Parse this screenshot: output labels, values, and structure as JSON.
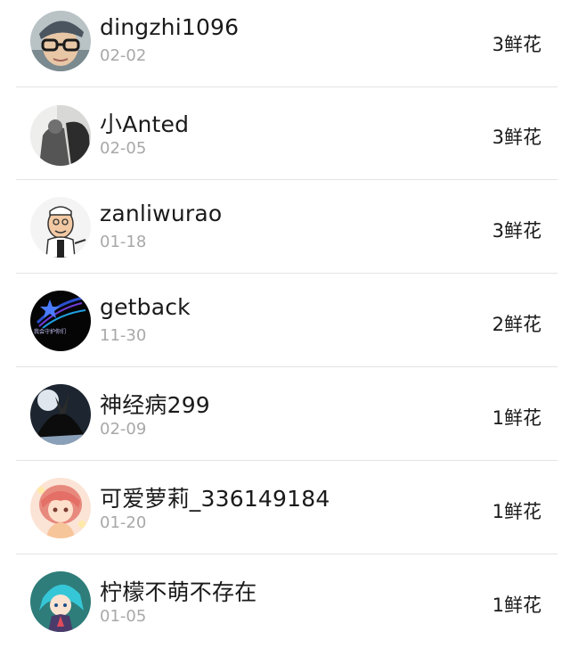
{
  "flower_list": {
    "items": [
      {
        "name": "dingzhi1096",
        "date": "02-02",
        "flowers": "3鲜花",
        "avatar": "boy-with-glasses-icon"
      },
      {
        "name": "小Anted",
        "date": "02-05",
        "flowers": "3鲜花",
        "avatar": "dark-photo-icon"
      },
      {
        "name": "zanliwurao",
        "date": "01-18",
        "flowers": "3鲜花",
        "avatar": "cartoon-chef-icon"
      },
      {
        "name": "getback",
        "date": "11-30",
        "flowers": "2鲜花",
        "avatar": "shooting-star-icon"
      },
      {
        "name": "神经病299",
        "date": "02-09",
        "flowers": "1鲜花",
        "avatar": "dark-wings-icon"
      },
      {
        "name": "可爱萝莉_336149184",
        "date": "01-20",
        "flowers": "1鲜花",
        "avatar": "anime-girl-icon"
      },
      {
        "name": "柠檬不萌不存在",
        "date": "01-05",
        "flowers": "1鲜花",
        "avatar": "anime-blue-hair-icon"
      }
    ]
  }
}
